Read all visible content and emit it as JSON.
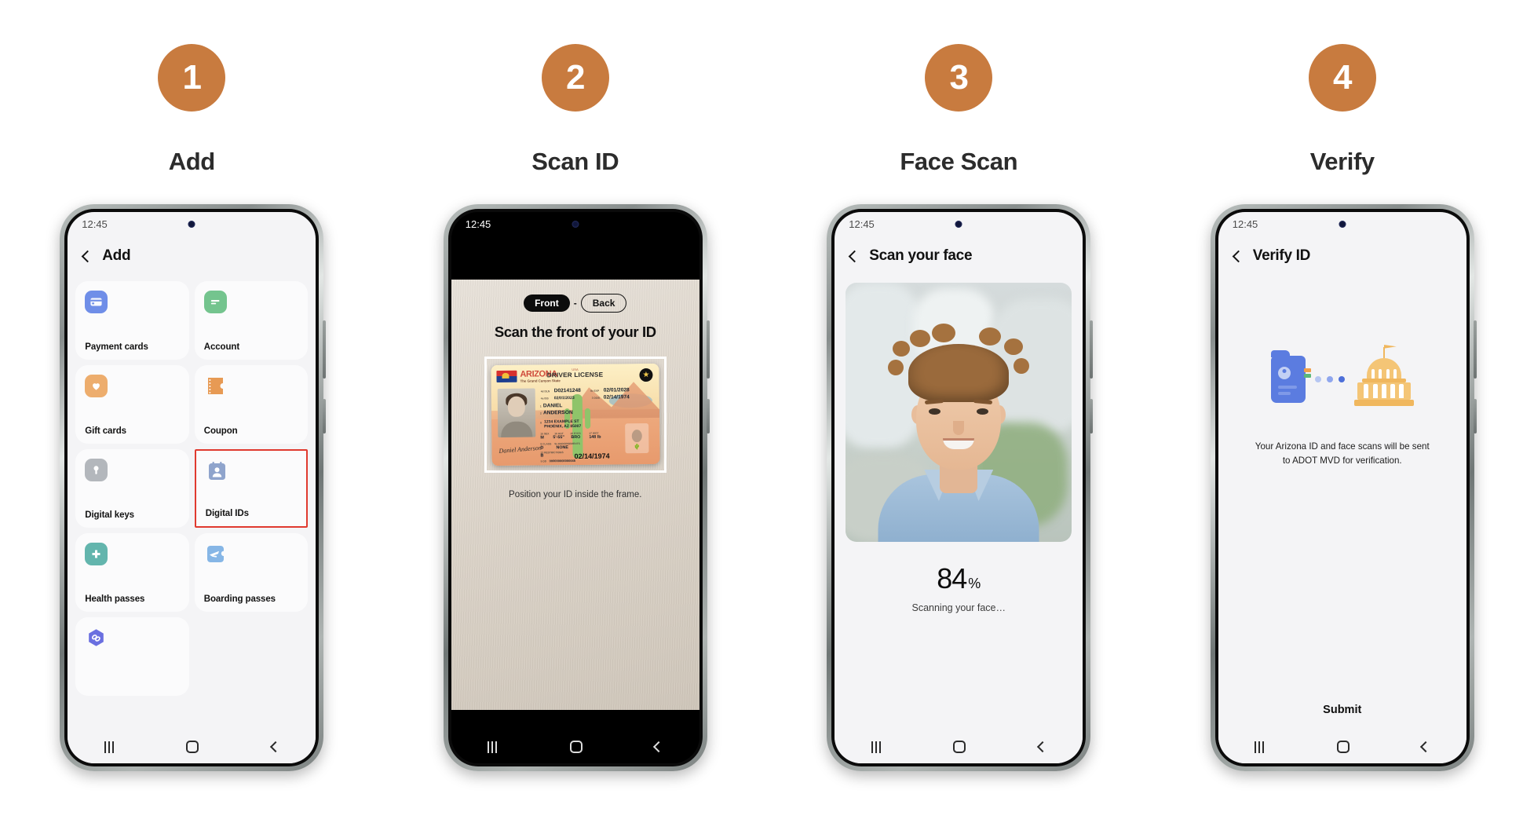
{
  "steps": [
    {
      "number": "1",
      "title": "Add"
    },
    {
      "number": "2",
      "title": "Scan ID"
    },
    {
      "number": "3",
      "title": "Face Scan"
    },
    {
      "number": "4",
      "title": "Verify"
    }
  ],
  "colors": {
    "badge": "#c87b3f",
    "highlight": "#e03a2f",
    "screen_bg": "#f4f4f6"
  },
  "phone1": {
    "status_time": "12:45",
    "appbar_title": "Add",
    "back_icon": "chevron-left-icon",
    "tiles": [
      {
        "label": "Payment cards",
        "icon": "credit-card-icon",
        "color": "#6f8ee8",
        "highlighted": false
      },
      {
        "label": "Account",
        "icon": "account-card-icon",
        "color": "#74c48e",
        "highlighted": false
      },
      {
        "label": "Gift cards",
        "icon": "gift-heart-icon",
        "color": "#edad6d",
        "highlighted": false
      },
      {
        "label": "Coupon",
        "icon": "coupon-ticket-icon",
        "color": "#e79a54",
        "highlighted": false
      },
      {
        "label": "Digital keys",
        "icon": "key-lock-icon",
        "color": "#b3b7bc",
        "highlighted": false
      },
      {
        "label": "Digital IDs",
        "icon": "id-badge-icon",
        "color": "#8fa4cc",
        "highlighted": true
      },
      {
        "label": "Health passes",
        "icon": "medical-cross-icon",
        "color": "#63b5ad",
        "highlighted": false
      },
      {
        "label": "Boarding passes",
        "icon": "airplane-icon",
        "color": "#86b6e6",
        "highlighted": false
      },
      {
        "label": "",
        "icon": "blockchain-link-icon",
        "color": "#6a6fe0",
        "highlighted": false
      }
    ],
    "nav": {
      "recent": "recents-icon",
      "home": "home-icon",
      "back": "back-icon"
    }
  },
  "phone2": {
    "status_time": "12:45",
    "toggle_front": "Front",
    "toggle_dash": "-",
    "toggle_back": "Back",
    "title": "Scan the front of your ID",
    "hint": "Position your ID inside the frame.",
    "license": {
      "state": "ARIZONA",
      "state_tagline": "The Grand Canyon State",
      "state_side": "USA",
      "doc_type": "DRIVER LICENSE",
      "star_icon": "gold-star-icon",
      "fields": [
        {
          "key": "4d DLN",
          "value": "D02141248"
        },
        {
          "key": "4b EXP",
          "value": "02/01/2028"
        },
        {
          "key": "4a ISS",
          "value": "02/01/2023"
        },
        {
          "key": "3 DOB",
          "value": "02/14/1974"
        },
        {
          "key": "1",
          "value": "DANIEL"
        },
        {
          "key": "2",
          "value": "ANDERSON"
        },
        {
          "key": "8",
          "value": "1234 EXAMPLE ST"
        },
        {
          "key": "",
          "value": "PHOENIX, AZ 85007"
        },
        {
          "key": "15 SEX",
          "value": "M"
        },
        {
          "key": "15 HGT",
          "value": "5'-55\""
        },
        {
          "key": "16 EYES",
          "value": "BRO"
        },
        {
          "key": "17 WGT",
          "value": "148 lb"
        },
        {
          "key": "9 CLASS",
          "value": "D"
        },
        {
          "key": "9a ENDORSEMENTS",
          "value": "NONE"
        },
        {
          "key": "12 RESTRICTIONS",
          "value": "B"
        },
        {
          "key": "5 DD",
          "value": "000000000000045"
        }
      ],
      "dob_large": "02/14/1974",
      "signature": "Daniel Anderson"
    },
    "nav": {
      "recent": "recents-icon",
      "home": "home-icon",
      "back": "back-icon"
    }
  },
  "phone3": {
    "status_time": "12:45",
    "appbar_title": "Scan your face",
    "back_icon": "chevron-left-icon",
    "percent": "84",
    "percent_symbol": "%",
    "status_text": "Scanning your face…",
    "nav": {
      "recent": "recents-icon",
      "home": "home-icon",
      "back": "back-icon"
    }
  },
  "phone4": {
    "status_time": "12:45",
    "appbar_title": "Verify ID",
    "back_icon": "chevron-left-icon",
    "illustration": {
      "id_icon": "id-card-icon",
      "transfer_icon": "transfer-dots-icon",
      "government_icon": "capitol-building-icon",
      "dot_colors": [
        "#b6c6f2",
        "#8fa6ee",
        "#4d6fd9"
      ]
    },
    "message_line1": "Your Arizona ID and face scans will be sent",
    "message_line2": "to ADOT MVD for verification.",
    "submit_label": "Submit",
    "nav": {
      "recent": "recents-icon",
      "home": "home-icon",
      "back": "back-icon"
    }
  }
}
